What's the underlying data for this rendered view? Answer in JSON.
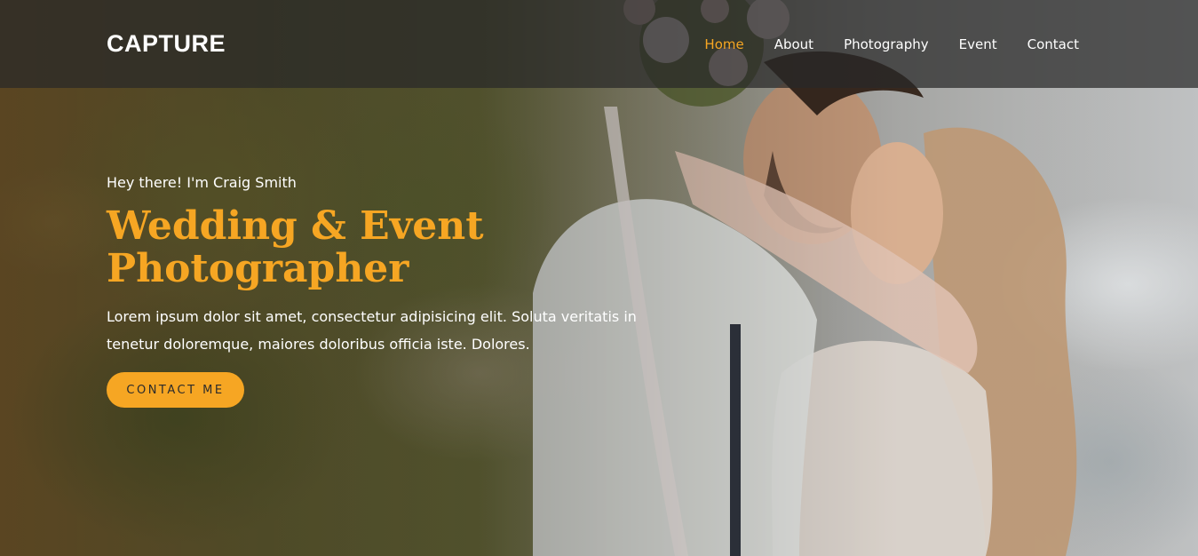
{
  "brand": {
    "name": "CAPTURE"
  },
  "nav": {
    "items": [
      {
        "label": "Home",
        "active": true
      },
      {
        "label": "About",
        "active": false
      },
      {
        "label": "Photography",
        "active": false
      },
      {
        "label": "Event",
        "active": false
      },
      {
        "label": "Contact",
        "active": false
      }
    ]
  },
  "hero": {
    "intro": "Hey there! I'm Craig Smith",
    "headline": "Wedding & Event Photographer",
    "description": "Lorem ipsum dolor sit amet, consectetur adipisicing elit. Soluta veritatis in tenetur doloremque, maiores doloribus officia iste. Dolores.",
    "cta_label": "CONTACT ME",
    "background_image": "wedding-couple-photo"
  },
  "colors": {
    "accent": "#f6a623",
    "nav_bg": "#282828",
    "text": "#ffffff"
  }
}
